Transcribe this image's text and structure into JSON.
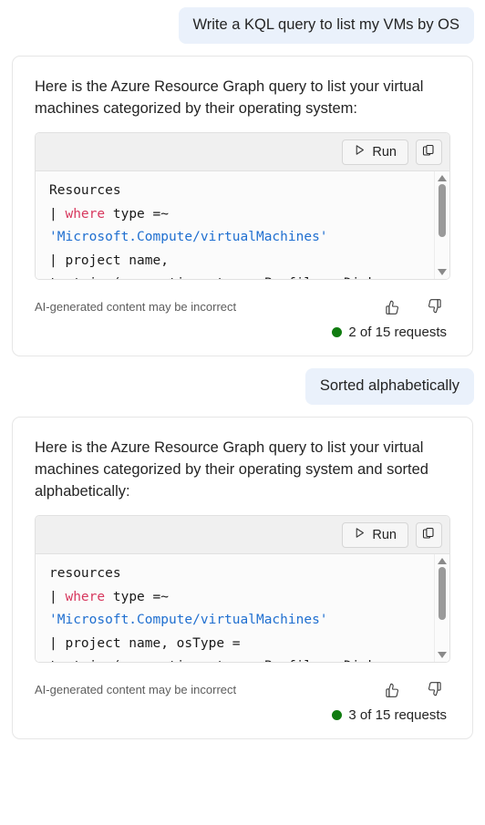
{
  "conversation": [
    {
      "user_message": "Write a KQL query to list my VMs by OS",
      "assistant": {
        "answer": "Here is the Azure Resource Graph query to list your virtual machines categorized by their operating system:",
        "code_block": {
          "run_label": "Run",
          "run_icon": "play-icon",
          "copy_icon": "copy-icon",
          "lines": [
            [
              {
                "t": "Resources",
                "c": "plain"
              }
            ],
            [
              {
                "t": "| ",
                "c": "plain"
              },
              {
                "t": "where",
                "c": "kw"
              },
              {
                "t": " type =~",
                "c": "plain"
              }
            ],
            [
              {
                "t": "'Microsoft.Compute/virtualMachines'",
                "c": "str"
              }
            ],
            [
              {
                "t": "| project name,",
                "c": "plain"
              }
            ],
            [
              {
                "t": "tostring(properties.storageProfile.osDisk",
                "c": "plain"
              }
            ]
          ]
        },
        "disclaimer": "AI-generated content may be incorrect",
        "thumbs_up_icon": "thumbs-up-icon",
        "thumbs_down_icon": "thumbs-down-icon",
        "quota": "2 of 15 requests",
        "quota_dot_color": "#107c10"
      }
    },
    {
      "user_message": "Sorted alphabetically",
      "assistant": {
        "answer": "Here is the Azure Resource Graph query to list your virtual machines categorized by their operating system and sorted alphabetically:",
        "code_block": {
          "run_label": "Run",
          "run_icon": "play-icon",
          "copy_icon": "copy-icon",
          "lines": [
            [
              {
                "t": "resources",
                "c": "plain"
              }
            ],
            [
              {
                "t": "| ",
                "c": "plain"
              },
              {
                "t": "where",
                "c": "kw"
              },
              {
                "t": " type =~",
                "c": "plain"
              }
            ],
            [
              {
                "t": "'Microsoft.Compute/virtualMachines'",
                "c": "str"
              }
            ],
            [
              {
                "t": "| project name, osType =",
                "c": "plain"
              }
            ],
            [
              {
                "t": "tostring(properties.storageProfile.osDisk",
                "c": "plain"
              }
            ]
          ]
        },
        "disclaimer": "AI-generated content may be incorrect",
        "thumbs_up_icon": "thumbs-up-icon",
        "thumbs_down_icon": "thumbs-down-icon",
        "quota": "3 of 15 requests",
        "quota_dot_color": "#107c10"
      }
    }
  ],
  "colors": {
    "user_bubble": "#eaf1fb",
    "keyword": "#d7385e",
    "string": "#1f6fd0",
    "quota_green": "#107c10"
  }
}
